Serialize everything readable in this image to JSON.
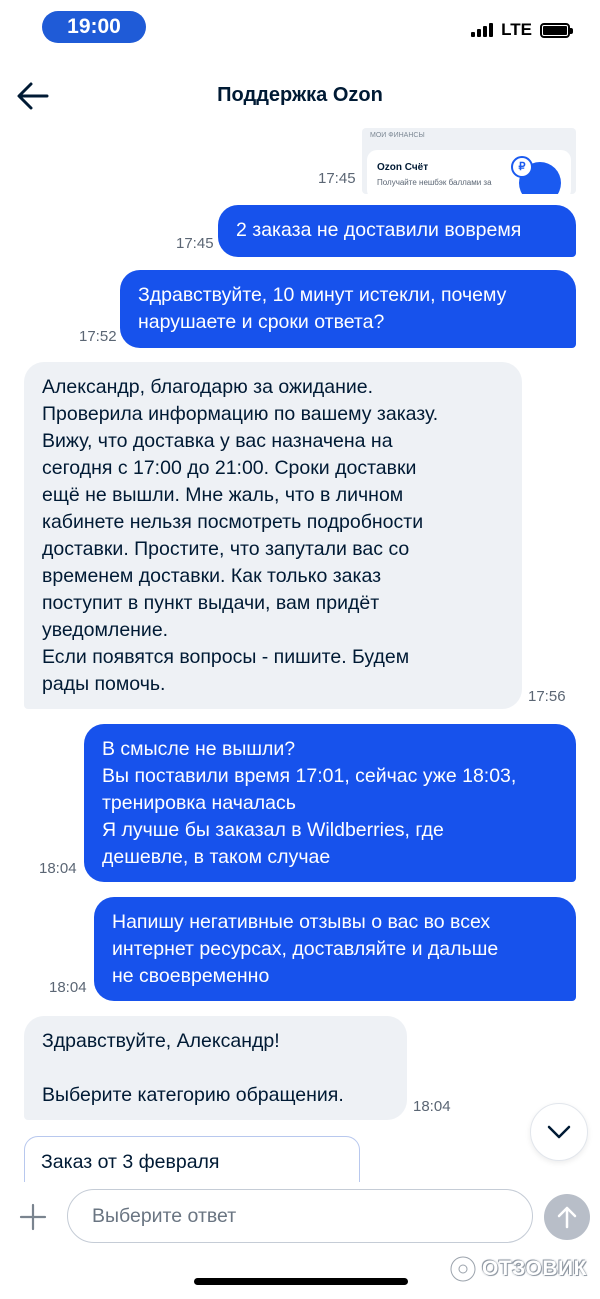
{
  "status_bar": {
    "time": "19:00",
    "network": "LTE"
  },
  "header": {
    "title": "Поддержка Ozon",
    "back_icon": "arrow-left-icon"
  },
  "card_preview": {
    "caption": "мои финансы",
    "title": "Ozon Счёт",
    "subtitle": "Получайте нешбэк баллами за",
    "time": "17:45"
  },
  "messages": [
    {
      "direction": "out",
      "time": "17:45",
      "lines": [
        "2 заказа не доставили вовремя"
      ]
    },
    {
      "direction": "out",
      "time": "17:52",
      "lines": [
        "Здравствуйте, 10 минут истекли, почему",
        "нарушаете и сроки ответа?"
      ]
    },
    {
      "direction": "in",
      "time": "17:56",
      "lines": [
        "Александр, благодарю за ожидание.",
        "Проверила информацию по вашему заказу.",
        "Вижу, что доставка у вас назначена на",
        "сегодня с 17:00 до 21:00. Сроки доставки",
        "ещё не вышли. Мне жаль, что в личном",
        "кабинете нельзя посмотреть подробности",
        "доставки. Простите, что запутали вас со",
        "временем доставки. Как только заказ",
        "поступит в пункт выдачи, вам придёт",
        "уведомление.",
        "Если появятся вопросы - пишите. Будем",
        "рады помочь."
      ]
    },
    {
      "direction": "out",
      "time": "18:04",
      "lines": [
        "В смысле не вышли?",
        "Вы поставили время 17:01, сейчас уже 18:03,",
        "тренировка началась",
        "Я лучше бы заказал в Wildberries, где",
        "дешевле, в таком случае"
      ]
    },
    {
      "direction": "out",
      "time": "18:04",
      "lines": [
        "Напишу негативные отзывы о вас во всех",
        "интернет ресурсах, доставляйте и дальше",
        "не своевременно"
      ]
    },
    {
      "direction": "in",
      "time": "18:04",
      "lines": [
        "Здравствуйте, Александр!",
        "",
        "Выберите категорию обращения."
      ]
    }
  ],
  "option_chip": "Заказ от 3 февраля",
  "composer": {
    "placeholder": "Выберите ответ"
  },
  "watermark": "ОТЗОВИК",
  "colors": {
    "outgoing_bubble": "#1752ec",
    "incoming_bubble": "#eef1f5",
    "status_time_bg": "#1f5bd7"
  }
}
